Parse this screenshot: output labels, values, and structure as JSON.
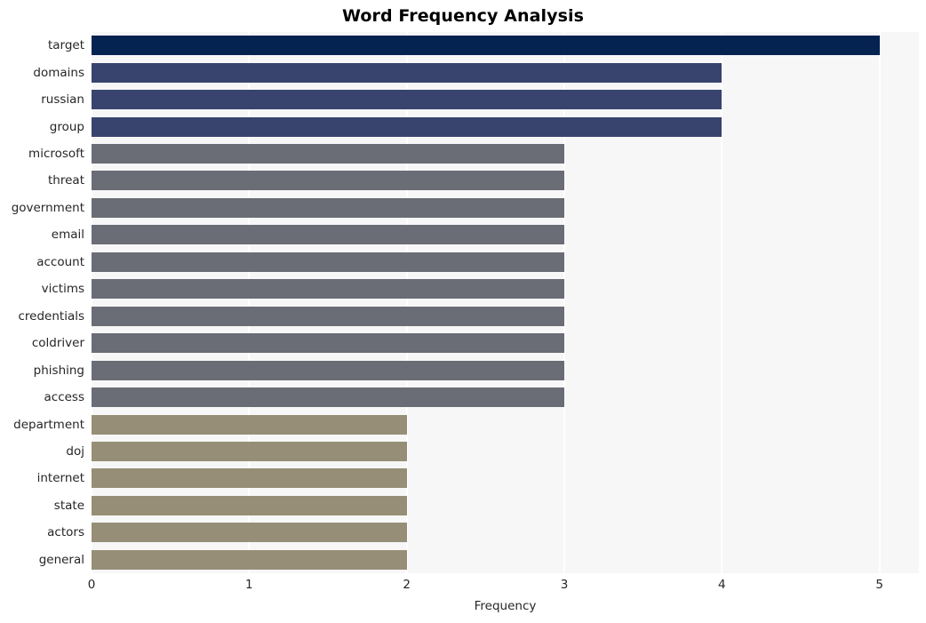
{
  "chart_data": {
    "type": "bar",
    "orientation": "horizontal",
    "title": "Word Frequency Analysis",
    "xlabel": "Frequency",
    "ylabel": "",
    "xlim": [
      0,
      5.25
    ],
    "xticks": [
      0,
      1,
      2,
      3,
      4,
      5
    ],
    "xtick_labels": [
      "0",
      "1",
      "2",
      "3",
      "4",
      "5"
    ],
    "grid": true,
    "grid_axis": "x",
    "legend": false,
    "categories": [
      "target",
      "domains",
      "russian",
      "group",
      "microsoft",
      "threat",
      "government",
      "email",
      "account",
      "victims",
      "credentials",
      "coldriver",
      "phishing",
      "access",
      "department",
      "doj",
      "internet",
      "state",
      "actors",
      "general"
    ],
    "values": [
      5,
      4,
      4,
      4,
      3,
      3,
      3,
      3,
      3,
      3,
      3,
      3,
      3,
      3,
      2,
      2,
      2,
      2,
      2,
      2
    ],
    "bar_colors": [
      "#042350",
      "#38446e",
      "#38446e",
      "#38446e",
      "#6a6c76",
      "#6a6c76",
      "#6a6c76",
      "#6a6c76",
      "#6a6c76",
      "#6a6c76",
      "#6a6c76",
      "#6a6c76",
      "#6a6c76",
      "#6a6c76",
      "#968e77",
      "#968e77",
      "#968e77",
      "#968e77",
      "#968e77",
      "#968e77"
    ]
  },
  "style": {
    "plot_background": "#f7f7f7",
    "figure_background": "#ffffff",
    "gridline_color": "#ffffff",
    "tick_text_color": "#262626",
    "title_color": "#000000"
  }
}
